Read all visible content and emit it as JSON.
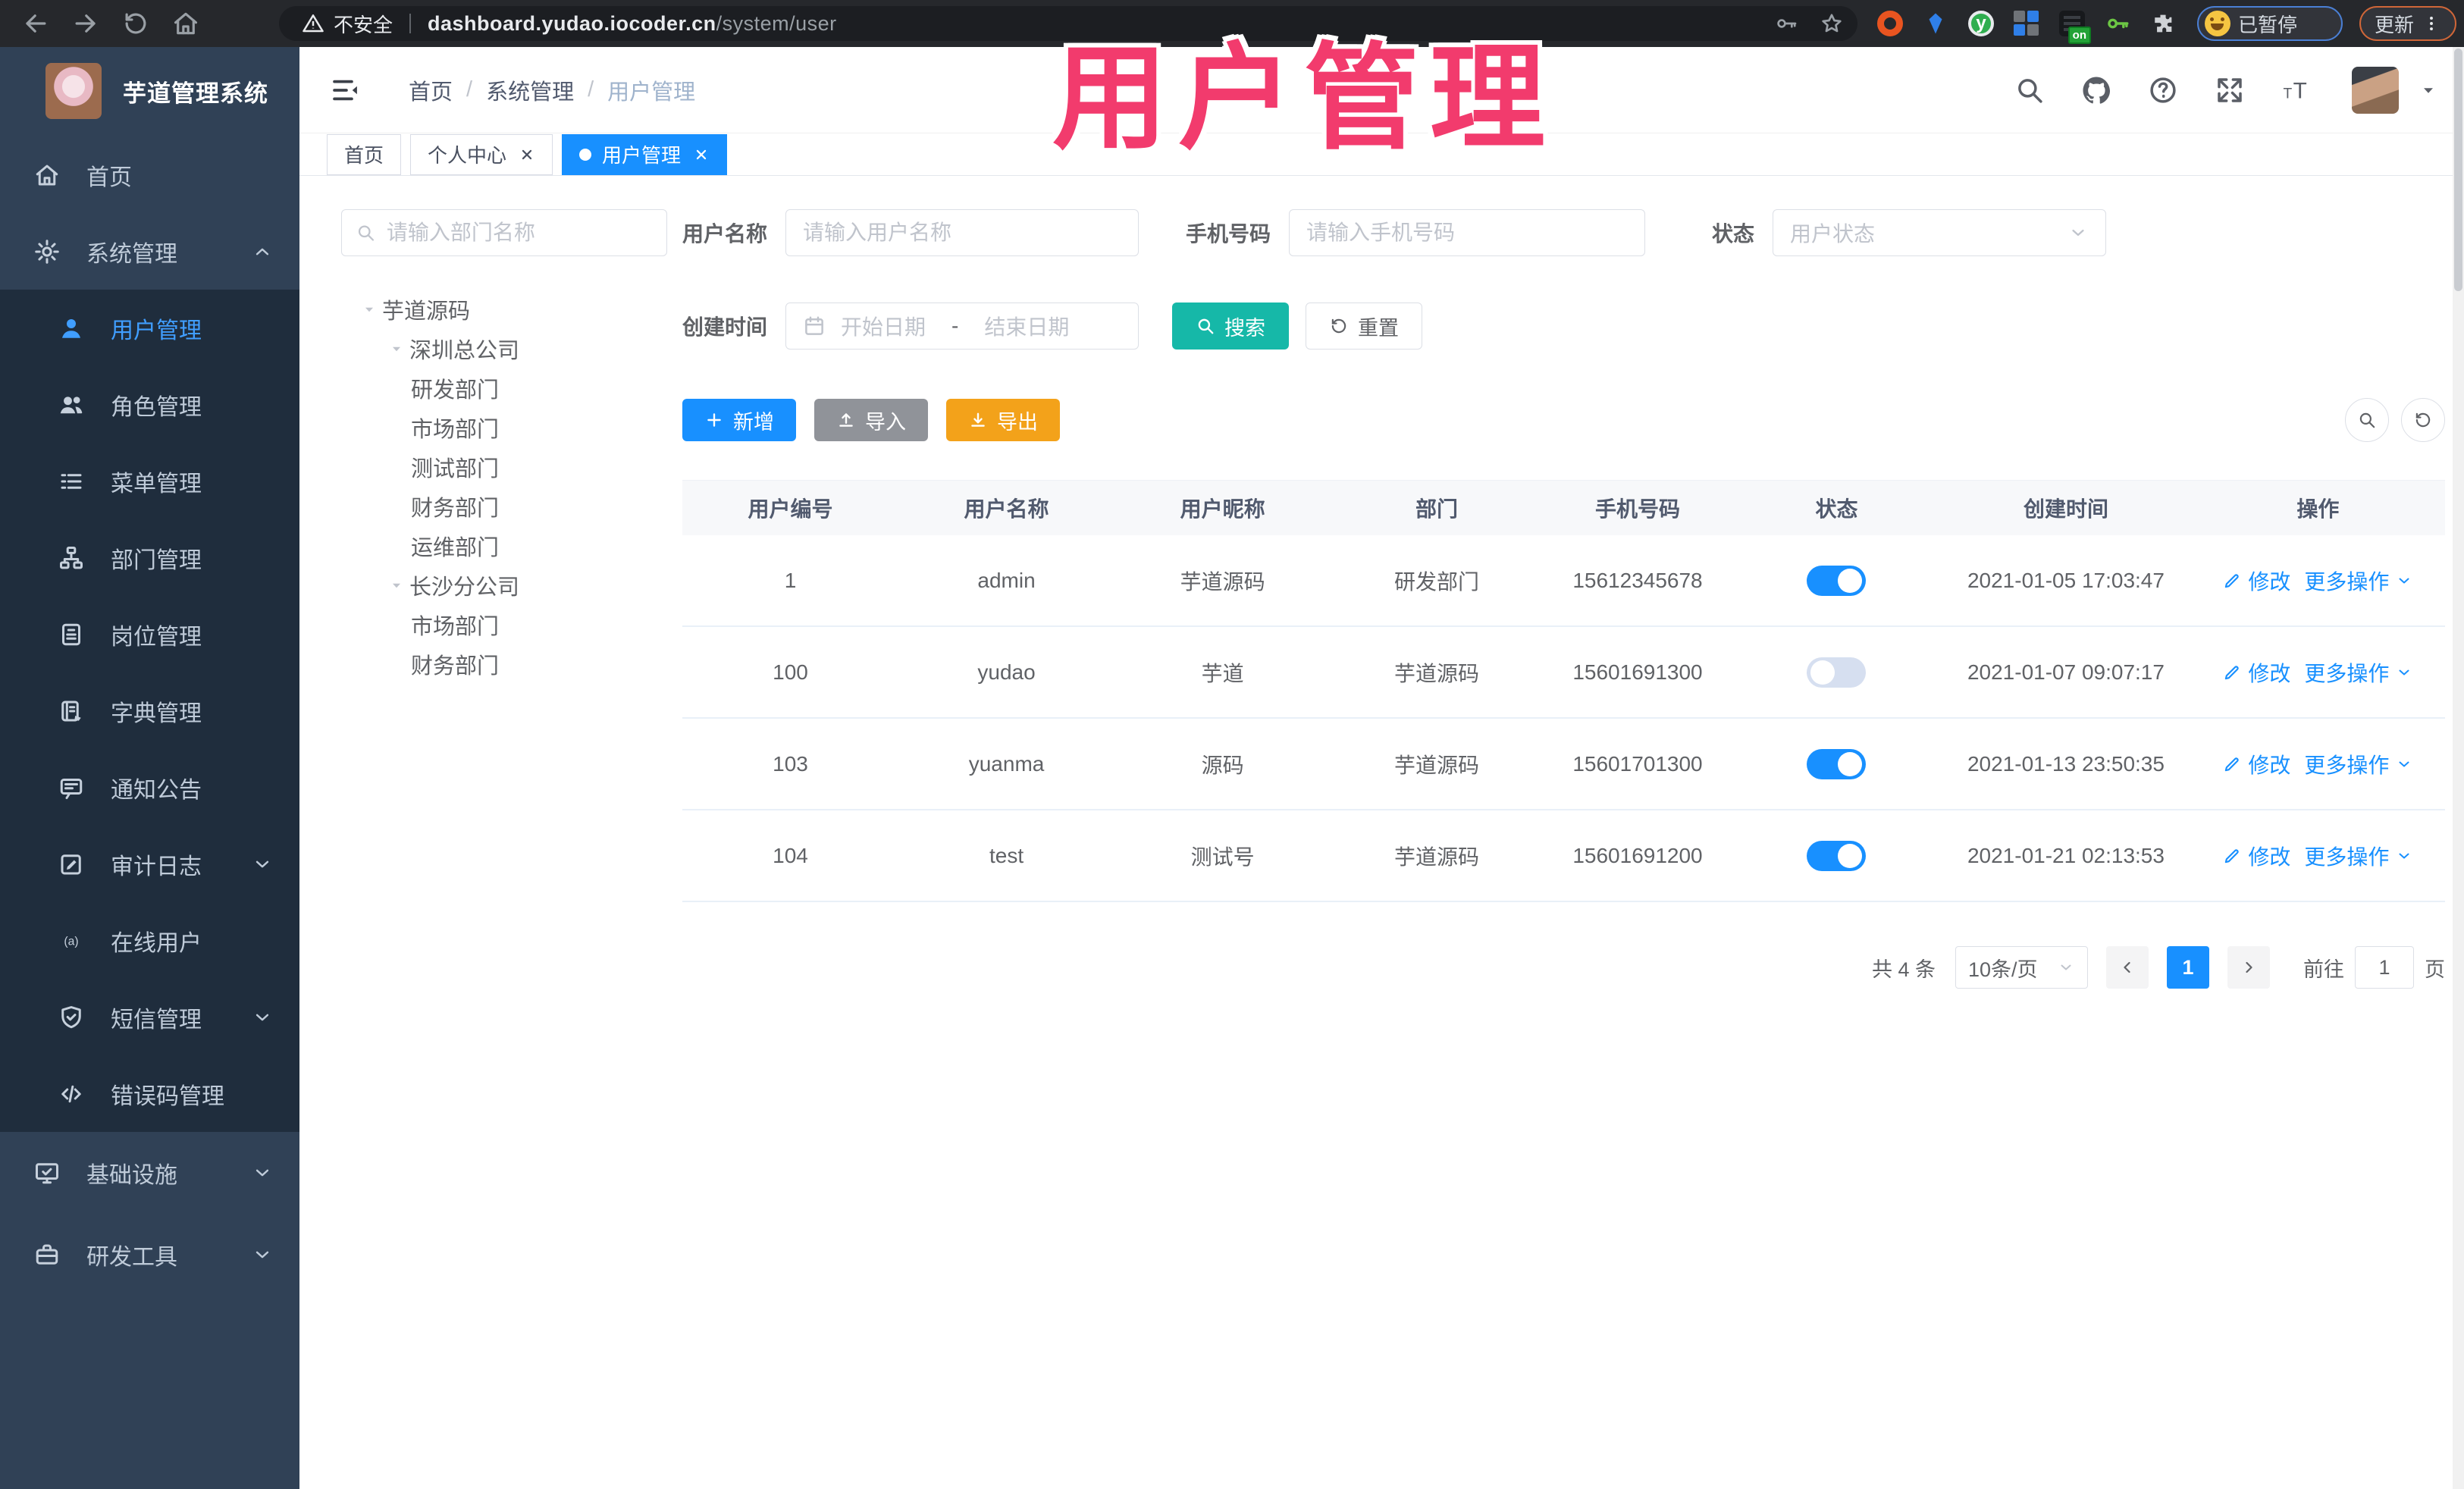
{
  "browser": {
    "security_label": "不安全",
    "url_domain": "dashboard.yudao.iocoder.cn",
    "url_path": "/system/user",
    "ext_on_badge": "on",
    "ext_y_letter": "y",
    "paused_label": "已暂停",
    "update_label": "更新"
  },
  "watermark": "用户管理",
  "sidebar": {
    "title": "芋道管理系统",
    "menu": [
      {
        "label": "首页",
        "icon": "home"
      },
      {
        "label": "系统管理",
        "icon": "gear",
        "chevron": "up"
      },
      {
        "label": "用户管理",
        "icon": "user",
        "sub": true,
        "active": true
      },
      {
        "label": "角色管理",
        "icon": "users",
        "sub": true
      },
      {
        "label": "菜单管理",
        "icon": "menu-list",
        "sub": true
      },
      {
        "label": "部门管理",
        "icon": "org-tree",
        "sub": true
      },
      {
        "label": "岗位管理",
        "icon": "id-badge",
        "sub": true
      },
      {
        "label": "字典管理",
        "icon": "dictionary",
        "sub": true
      },
      {
        "label": "通知公告",
        "icon": "announcement",
        "sub": true
      },
      {
        "label": "审计日志",
        "icon": "audit-log",
        "sub": true,
        "chevron": "down"
      },
      {
        "label": "在线用户",
        "icon": "online-user",
        "sub": true
      },
      {
        "label": "短信管理",
        "icon": "sms-shield",
        "sub": true,
        "chevron": "down"
      },
      {
        "label": "错误码管理",
        "icon": "code",
        "sub": true
      },
      {
        "label": "基础设施",
        "icon": "infrastructure",
        "top2": true,
        "chevron": "down"
      },
      {
        "label": "研发工具",
        "icon": "dev-tools",
        "top2": true,
        "chevron": "down"
      }
    ]
  },
  "header": {
    "breadcrumb": [
      "首页",
      "系统管理",
      "用户管理"
    ],
    "breadcrumb_separator": "/"
  },
  "tabs": [
    {
      "label": "首页"
    },
    {
      "label": "个人中心",
      "closable": true
    },
    {
      "label": "用户管理",
      "closable": true,
      "active": true
    }
  ],
  "dept": {
    "search_placeholder": "请输入部门名称",
    "tree": [
      {
        "label": "芋道源码",
        "level": 0,
        "expandable": true
      },
      {
        "label": "深圳总公司",
        "level": 1,
        "expandable": true
      },
      {
        "label": "研发部门",
        "level": 2
      },
      {
        "label": "市场部门",
        "level": 2
      },
      {
        "label": "测试部门",
        "level": 2
      },
      {
        "label": "财务部门",
        "level": 2
      },
      {
        "label": "运维部门",
        "level": 2
      },
      {
        "label": "长沙分公司",
        "level": 1,
        "expandable": true
      },
      {
        "label": "市场部门",
        "level": 2
      },
      {
        "label": "财务部门",
        "level": 2
      }
    ]
  },
  "filters": {
    "username_label": "用户名称",
    "username_placeholder": "请输入用户名称",
    "mobile_label": "手机号码",
    "mobile_placeholder": "请输入手机号码",
    "status_label": "状态",
    "status_placeholder": "用户状态",
    "create_time_label": "创建时间",
    "range_start_placeholder": "开始日期",
    "range_separator": "-",
    "range_end_placeholder": "结束日期",
    "search_label": "搜索",
    "reset_label": "重置"
  },
  "toolbar": {
    "add_label": "新增",
    "import_label": "导入",
    "export_label": "导出"
  },
  "table": {
    "columns": [
      "用户编号",
      "用户名称",
      "用户昵称",
      "部门",
      "手机号码",
      "状态",
      "创建时间",
      "操作"
    ],
    "action_edit": "修改",
    "action_more": "更多操作",
    "rows": [
      {
        "id": "1",
        "username": "admin",
        "nickname": "芋道源码",
        "dept": "研发部门",
        "mobile": "15612345678",
        "status": true,
        "create_time": "2021-01-05 17:03:47"
      },
      {
        "id": "100",
        "username": "yudao",
        "nickname": "芋道",
        "dept": "芋道源码",
        "mobile": "15601691300",
        "status": false,
        "create_time": "2021-01-07 09:07:17"
      },
      {
        "id": "103",
        "username": "yuanma",
        "nickname": "源码",
        "dept": "芋道源码",
        "mobile": "15601701300",
        "status": true,
        "create_time": "2021-01-13 23:50:35"
      },
      {
        "id": "104",
        "username": "test",
        "nickname": "测试号",
        "dept": "芋道源码",
        "mobile": "15601691200",
        "status": true,
        "create_time": "2021-01-21 02:13:53"
      }
    ]
  },
  "pagination": {
    "total_text": "共 4 条",
    "page_size": "10条/页",
    "current_page": "1",
    "goto_label": "前往",
    "goto_value": "1",
    "page_unit": "页"
  },
  "colors": {
    "accent_blue": "#1890ff",
    "search_teal": "#16b8a8",
    "export_orange": "#f3a21a",
    "import_gray": "#909399",
    "sidebar_bg": "#304156",
    "submenu_bg": "#1f2d3d",
    "watermark_pink": "#f23b6d"
  }
}
